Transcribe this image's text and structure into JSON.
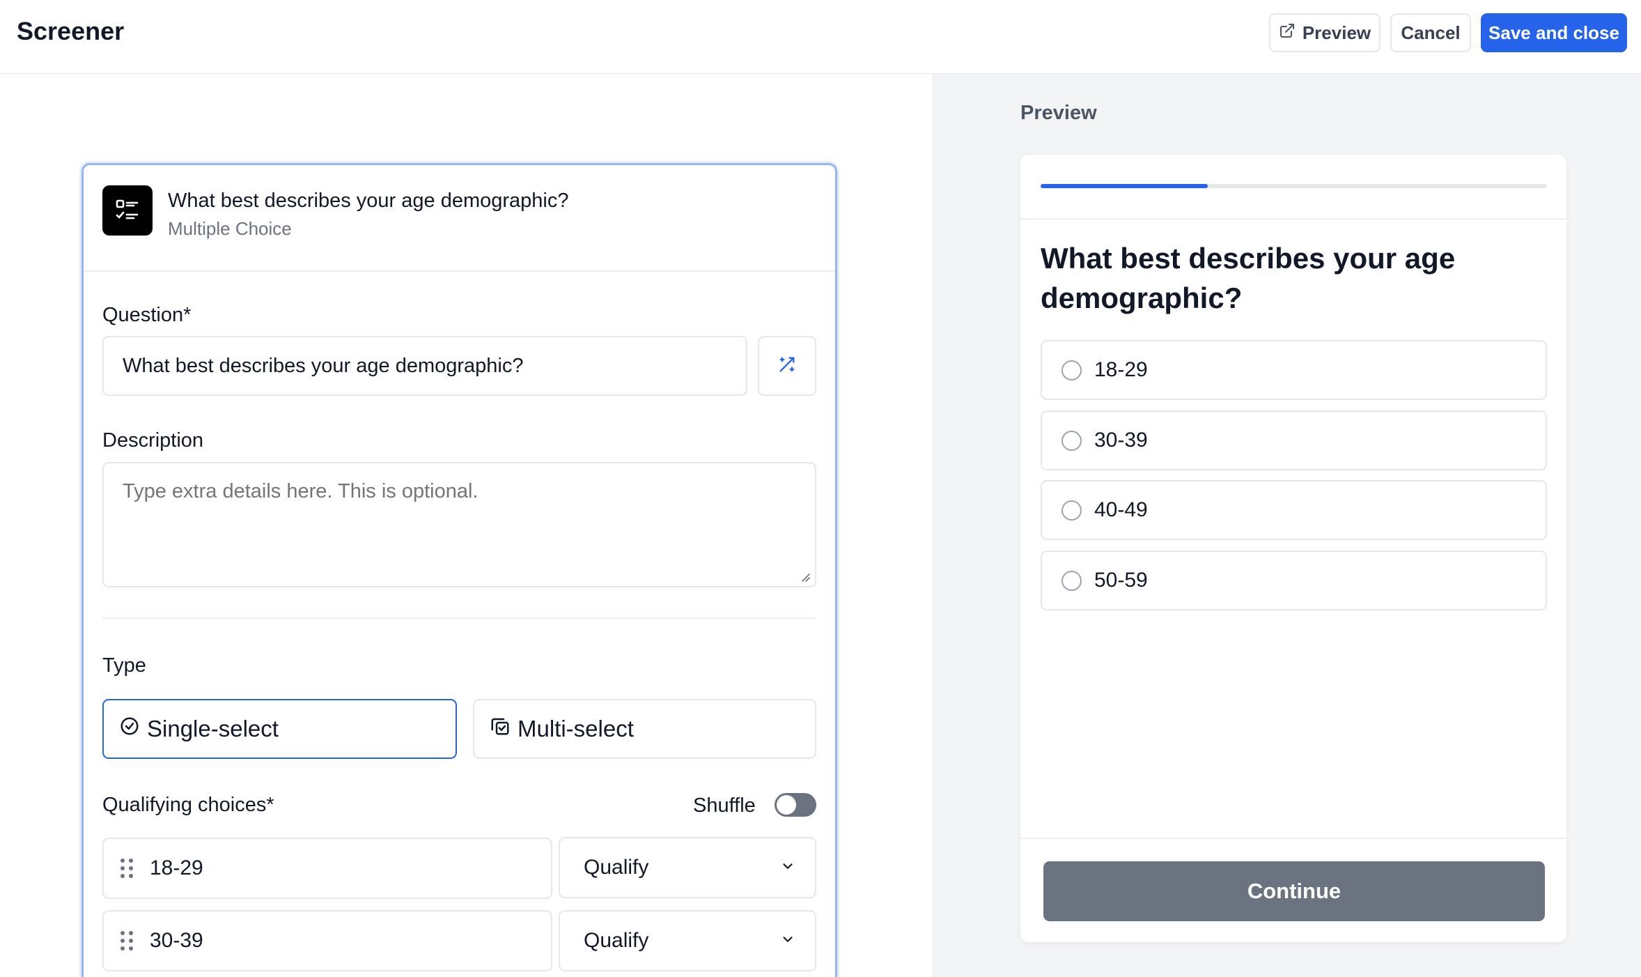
{
  "header": {
    "title": "Screener",
    "preview_label": "Preview",
    "cancel_label": "Cancel",
    "save_label": "Save and close"
  },
  "editor": {
    "question_title": "What best describes your age demographic?",
    "question_type": "Multiple Choice",
    "question_label": "Question*",
    "question_value": "What best describes your age demographic?",
    "description_label": "Description",
    "description_placeholder": "Type extra details here. This is optional.",
    "type_label": "Type",
    "type_options": [
      "Single-select",
      "Multi-select"
    ],
    "selected_type": "Single-select",
    "choices_label": "Qualifying choices*",
    "shuffle_label": "Shuffle",
    "shuffle_on": false,
    "choices": [
      {
        "label": "18-29",
        "action": "Qualify"
      },
      {
        "label": "30-39",
        "action": "Qualify"
      }
    ]
  },
  "preview": {
    "heading": "Preview",
    "progress": 0.33,
    "question": "What best describes your age demographic?",
    "options": [
      "18-29",
      "30-39",
      "40-49",
      "50-59"
    ],
    "continue_label": "Continue"
  },
  "colors": {
    "accent": "#2563eb",
    "continue_bg": "#6b7280",
    "preview_pane_bg": "#f3f4f6"
  }
}
